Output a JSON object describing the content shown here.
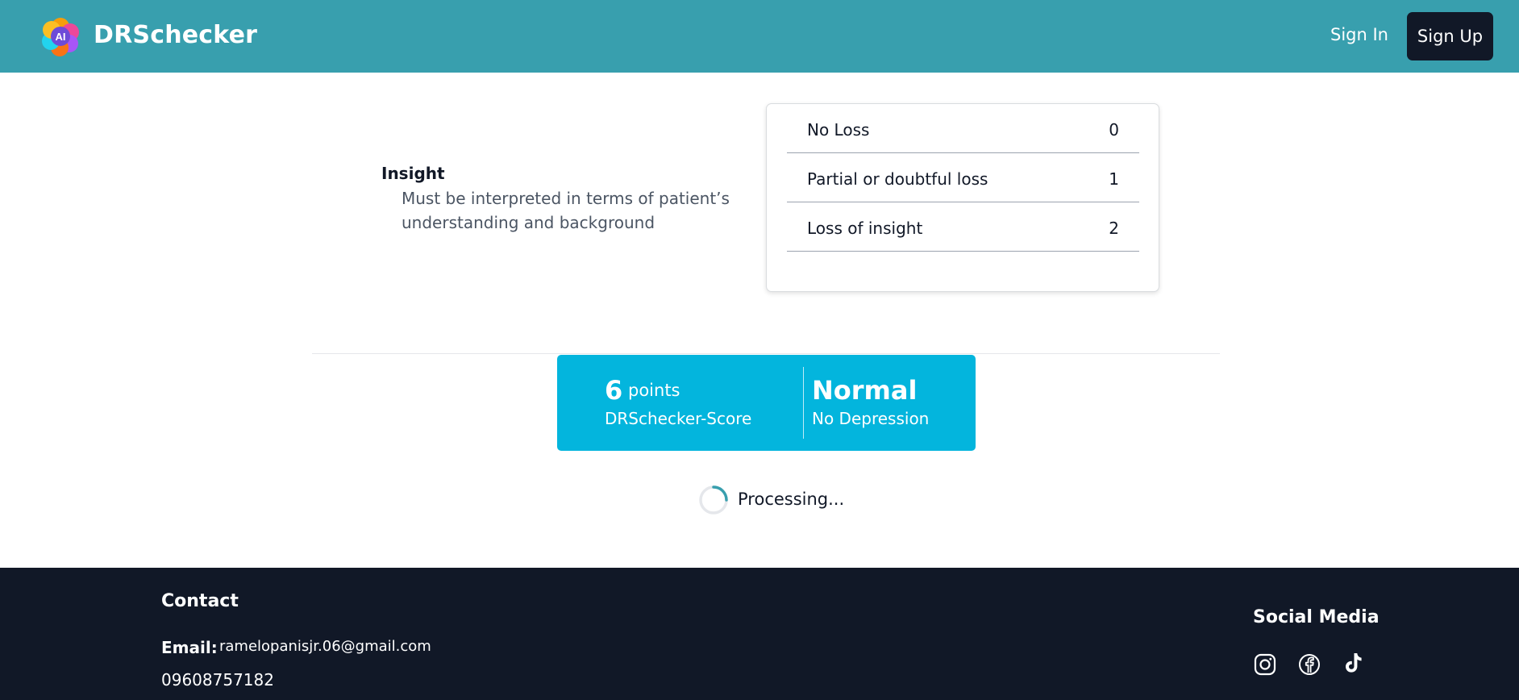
{
  "header": {
    "logo_text": "AI",
    "brand": "DRSchecker",
    "sign_in": "Sign In",
    "sign_up": "Sign Up"
  },
  "question": {
    "title": "Insight",
    "description": "Must be interpreted in terms of patient’s understanding and background",
    "options": [
      {
        "label": "No Loss",
        "score": "0"
      },
      {
        "label": "Partial or doubtful loss",
        "score": "1"
      },
      {
        "label": "Loss of insight",
        "score": "2"
      }
    ]
  },
  "result": {
    "points": "6",
    "points_unit": "points",
    "score_label": "DRSchecker-Score",
    "severity": "Normal",
    "severity_desc": "No Depression"
  },
  "status": {
    "processing": "Processing..."
  },
  "footer": {
    "contact_heading": "Contact",
    "email_label": "Email:",
    "email": "ramelopanisjr.06@gmail.com",
    "phone": "09608757182",
    "social_heading": "Social Media",
    "social_icons": [
      "instagram-icon",
      "facebook-icon",
      "tiktok-icon"
    ]
  },
  "colors": {
    "header_bg": "#389fae",
    "signup_bg": "#111827",
    "result_bg": "#03b5dd",
    "footer_bg": "#111827",
    "spinner_accent": "#389fae"
  }
}
